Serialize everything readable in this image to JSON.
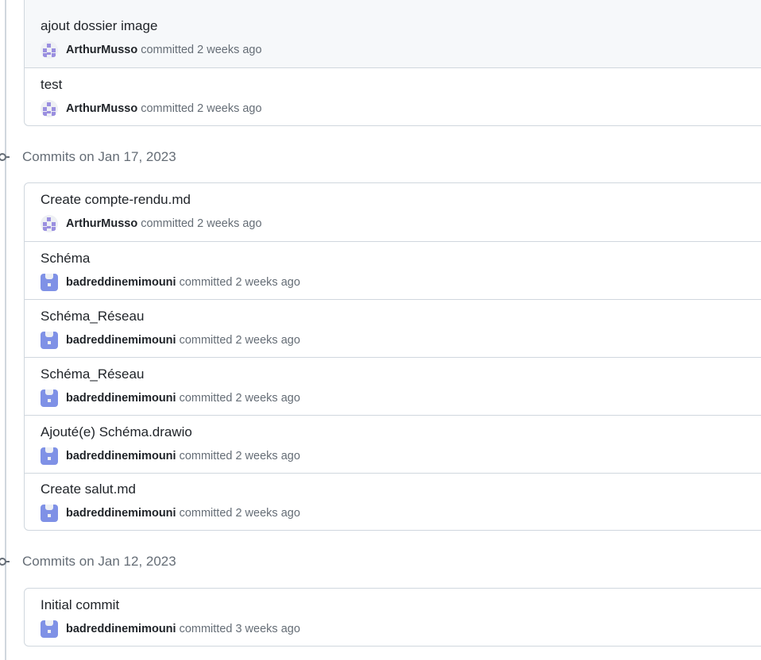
{
  "groups": [
    {
      "header": "",
      "commits": [
        {
          "title": "ajout dossier image",
          "author": "ArthurMusso",
          "verb": "committed",
          "when": "2 weeks ago",
          "avatar": "identicon-a",
          "highlight": true
        },
        {
          "title": "test",
          "author": "ArthurMusso",
          "verb": "committed",
          "when": "2 weeks ago",
          "avatar": "identicon-a",
          "highlight": false
        }
      ]
    },
    {
      "header": "Commits on Jan 17, 2023",
      "commits": [
        {
          "title": "Create compte-rendu.md",
          "author": "ArthurMusso",
          "verb": "committed",
          "when": "2 weeks ago",
          "avatar": "identicon-a"
        },
        {
          "title": "Schéma",
          "author": "badreddinemimouni",
          "verb": "committed",
          "when": "2 weeks ago",
          "avatar": "identicon-b"
        },
        {
          "title": "Schéma_Réseau",
          "author": "badreddinemimouni",
          "verb": "committed",
          "when": "2 weeks ago",
          "avatar": "identicon-b"
        },
        {
          "title": "Schéma_Réseau",
          "author": "badreddinemimouni",
          "verb": "committed",
          "when": "2 weeks ago",
          "avatar": "identicon-b"
        },
        {
          "title": "Ajouté(e) Schéma.drawio",
          "author": "badreddinemimouni",
          "verb": "committed",
          "when": "2 weeks ago",
          "avatar": "identicon-b"
        },
        {
          "title": "Create salut.md",
          "author": "badreddinemimouni",
          "verb": "committed",
          "when": "2 weeks ago",
          "avatar": "identicon-b"
        }
      ]
    },
    {
      "header": "Commits on Jan 12, 2023",
      "commits": [
        {
          "title": "Initial commit",
          "author": "badreddinemimouni",
          "verb": "committed",
          "when": "3 weeks ago",
          "avatar": "identicon-b"
        }
      ]
    }
  ],
  "colors": {
    "border": "#d0d7de",
    "muted": "#656d76",
    "text": "#1f2328",
    "identicon_a": "#9a8fe0",
    "identicon_b": "#7f91e6"
  }
}
